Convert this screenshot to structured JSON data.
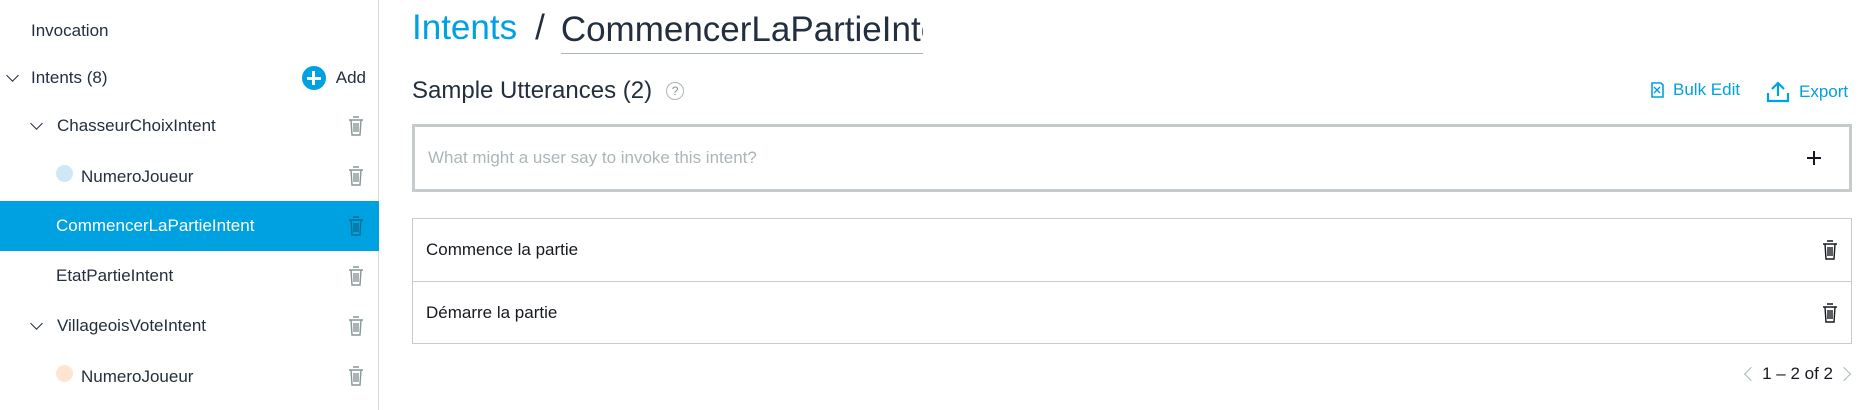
{
  "sidebar": {
    "invocation_label": "Invocation",
    "intents_label": "Intents (8)",
    "add_label": "Add",
    "items": [
      {
        "label": "ChasseurChoixIntent"
      },
      {
        "label": "NumeroJoueur",
        "slot_color": "#cfe8f7"
      },
      {
        "label": "CommencerLaPartieIntent",
        "active": true
      },
      {
        "label": "EtatPartieIntent"
      },
      {
        "label": "VillageoisVoteIntent"
      },
      {
        "label": "NumeroJoueur",
        "slot_color": "#fde5d2"
      }
    ]
  },
  "header": {
    "breadcrumb_link": "Intents",
    "separator": "/",
    "intent_name_value": "CommencerLaPartieInte"
  },
  "section": {
    "title": "Sample Utterances (2)",
    "help_glyph": "?",
    "bulk_edit_label": "Bulk Edit",
    "export_label": "Export"
  },
  "utterance_input": {
    "placeholder": "What might a user say to invoke this intent?",
    "value": ""
  },
  "utterances": [
    {
      "text": "Commence la partie"
    },
    {
      "text": "Démarre la partie"
    }
  ],
  "pagination": {
    "text": "1 – 2 of 2"
  },
  "colors": {
    "accent": "#00a1e0",
    "text": "#232f3e",
    "border": "#c6ccce"
  }
}
